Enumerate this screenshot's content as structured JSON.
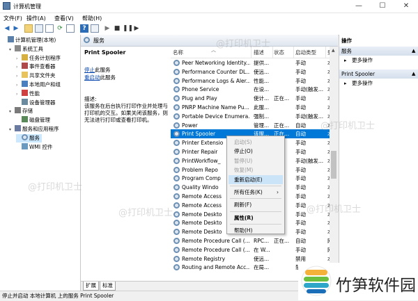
{
  "window": {
    "title": "计算机管理",
    "minimize": "—",
    "maximize": "☐",
    "close": "✕"
  },
  "menu": [
    "文件(F)",
    "操作(A)",
    "查看(V)",
    "帮助(H)"
  ],
  "tree": [
    {
      "label": "计算机管理(本地)",
      "indent": 0,
      "arrow": "",
      "icon": "computer-icon"
    },
    {
      "label": "系统工具",
      "indent": 1,
      "arrow": "▾",
      "icon": "tools-icon"
    },
    {
      "label": "任务计划程序",
      "indent": 2,
      "arrow": "›",
      "icon": "clock-icon"
    },
    {
      "label": "事件查看器",
      "indent": 2,
      "arrow": "›",
      "icon": "event-icon"
    },
    {
      "label": "共享文件夹",
      "indent": 2,
      "arrow": "›",
      "icon": "folder-icon"
    },
    {
      "label": "本地用户和组",
      "indent": 2,
      "arrow": "›",
      "icon": "users-icon"
    },
    {
      "label": "性能",
      "indent": 2,
      "arrow": "›",
      "icon": "performance-icon"
    },
    {
      "label": "设备管理器",
      "indent": 2,
      "arrow": "",
      "icon": "device-icon"
    },
    {
      "label": "存储",
      "indent": 1,
      "arrow": "▾",
      "icon": "storage-icon"
    },
    {
      "label": "磁盘管理",
      "indent": 2,
      "arrow": "",
      "icon": "disk-icon"
    },
    {
      "label": "服务和应用程序",
      "indent": 1,
      "arrow": "▾",
      "icon": "services-apps-icon"
    },
    {
      "label": "服务",
      "indent": 2,
      "arrow": "",
      "icon": "gear-icon",
      "selected": true
    },
    {
      "label": "WMI 控件",
      "indent": 2,
      "arrow": "",
      "icon": "wmi-icon"
    }
  ],
  "center": {
    "header": "服务",
    "service_name": "Print Spooler",
    "stop_link": "停止",
    "stop_suffix": "此服务",
    "restart_link": "重启动",
    "restart_suffix": "此服务",
    "desc_label": "描述:",
    "desc_text": "该服务在后台执行打印作业并处理与打印机的交互。如果关闭该服务，则无法进行打印或查看打印机。"
  },
  "columns": [
    "名称",
    "描述",
    "状态",
    "启动类型",
    "登"
  ],
  "rows": [
    [
      "Peer Networking Identity...",
      "提供...",
      "",
      "手动",
      "本"
    ],
    [
      "Performance Counter DL...",
      "使远...",
      "",
      "手动",
      "本"
    ],
    [
      "Performance Logs & Aler...",
      "性能...",
      "",
      "手动",
      "本"
    ],
    [
      "Phone Service",
      "在设...",
      "",
      "手动(触发...",
      "本"
    ],
    [
      "Plug and Play",
      "使计...",
      "正在...",
      "手动",
      "本"
    ],
    [
      "PNRP Machine Name Pu...",
      "此服...",
      "",
      "手动",
      "本"
    ],
    [
      "Portable Device Enumera...",
      "强制...",
      "",
      "手动(触发...",
      "本"
    ],
    [
      "Power",
      "管理...",
      "正在...",
      "自动",
      "本"
    ],
    [
      "Print Spooler",
      "该服...",
      "正在...",
      "自动",
      "本"
    ],
    [
      "Printer Extensio",
      "",
      "",
      "手动",
      "本"
    ],
    [
      "Printer Repair",
      "",
      "",
      "手动",
      "本"
    ],
    [
      "PrintWorkflow_",
      "",
      "",
      "手动(触发...",
      "本"
    ],
    [
      "Problem Repo",
      "",
      "",
      "手动",
      "本"
    ],
    [
      "Program Comp",
      "",
      "",
      "手动",
      "本"
    ],
    [
      "Quality Windo",
      "",
      "",
      "手动",
      "本"
    ],
    [
      "Remote Access",
      "",
      "",
      "手动",
      "本"
    ],
    [
      "Remote Access",
      "",
      "",
      "手动",
      "本"
    ],
    [
      "Remote Deskto",
      "",
      "",
      "手动",
      "本"
    ],
    [
      "Remote Deskto",
      "",
      "",
      "手动",
      "本"
    ],
    [
      "Remote Deskto",
      "",
      "",
      "手动",
      "本"
    ],
    [
      "Remote Procedure Call (...",
      "RPC...",
      "正在...",
      "自动",
      "网"
    ],
    [
      "Remote Procedure Call (...",
      "在 W...",
      "",
      "手动",
      "网"
    ],
    [
      "Remote Registry",
      "使远...",
      "",
      "禁用",
      "本"
    ],
    [
      "Routing and Remote Acc...",
      "在局...",
      "",
      "禁用",
      "本"
    ]
  ],
  "context_menu": [
    {
      "label": "启动(S)",
      "disabled": true
    },
    {
      "label": "停止(O)"
    },
    {
      "label": "暂停(U)",
      "disabled": true
    },
    {
      "label": "恢复(M)",
      "disabled": true
    },
    {
      "label": "重新启动(E)",
      "highlight": true
    },
    {
      "sep": true
    },
    {
      "label": "所有任务(K)",
      "submenu": "›"
    },
    {
      "sep": true
    },
    {
      "label": "刷新(F)"
    },
    {
      "sep": true
    },
    {
      "label": "属性(R)",
      "bold": true
    },
    {
      "sep": true
    },
    {
      "label": "帮助(H)"
    }
  ],
  "actions": {
    "header": "操作",
    "group1": "服务",
    "more1": "更多操作",
    "group2": "Print Spooler",
    "more2": "更多操作"
  },
  "tabs": [
    "扩展",
    "标准"
  ],
  "status": "停止并启动 本地计算机 上的服务 Print Spooler",
  "watermark": "@打印机卫士",
  "logo": {
    "text": "竹笋软件园"
  },
  "colors": {
    "selection": "#0078d7",
    "accent_green": "#3a9a3a",
    "logo_blue": "#1a6fb8"
  }
}
